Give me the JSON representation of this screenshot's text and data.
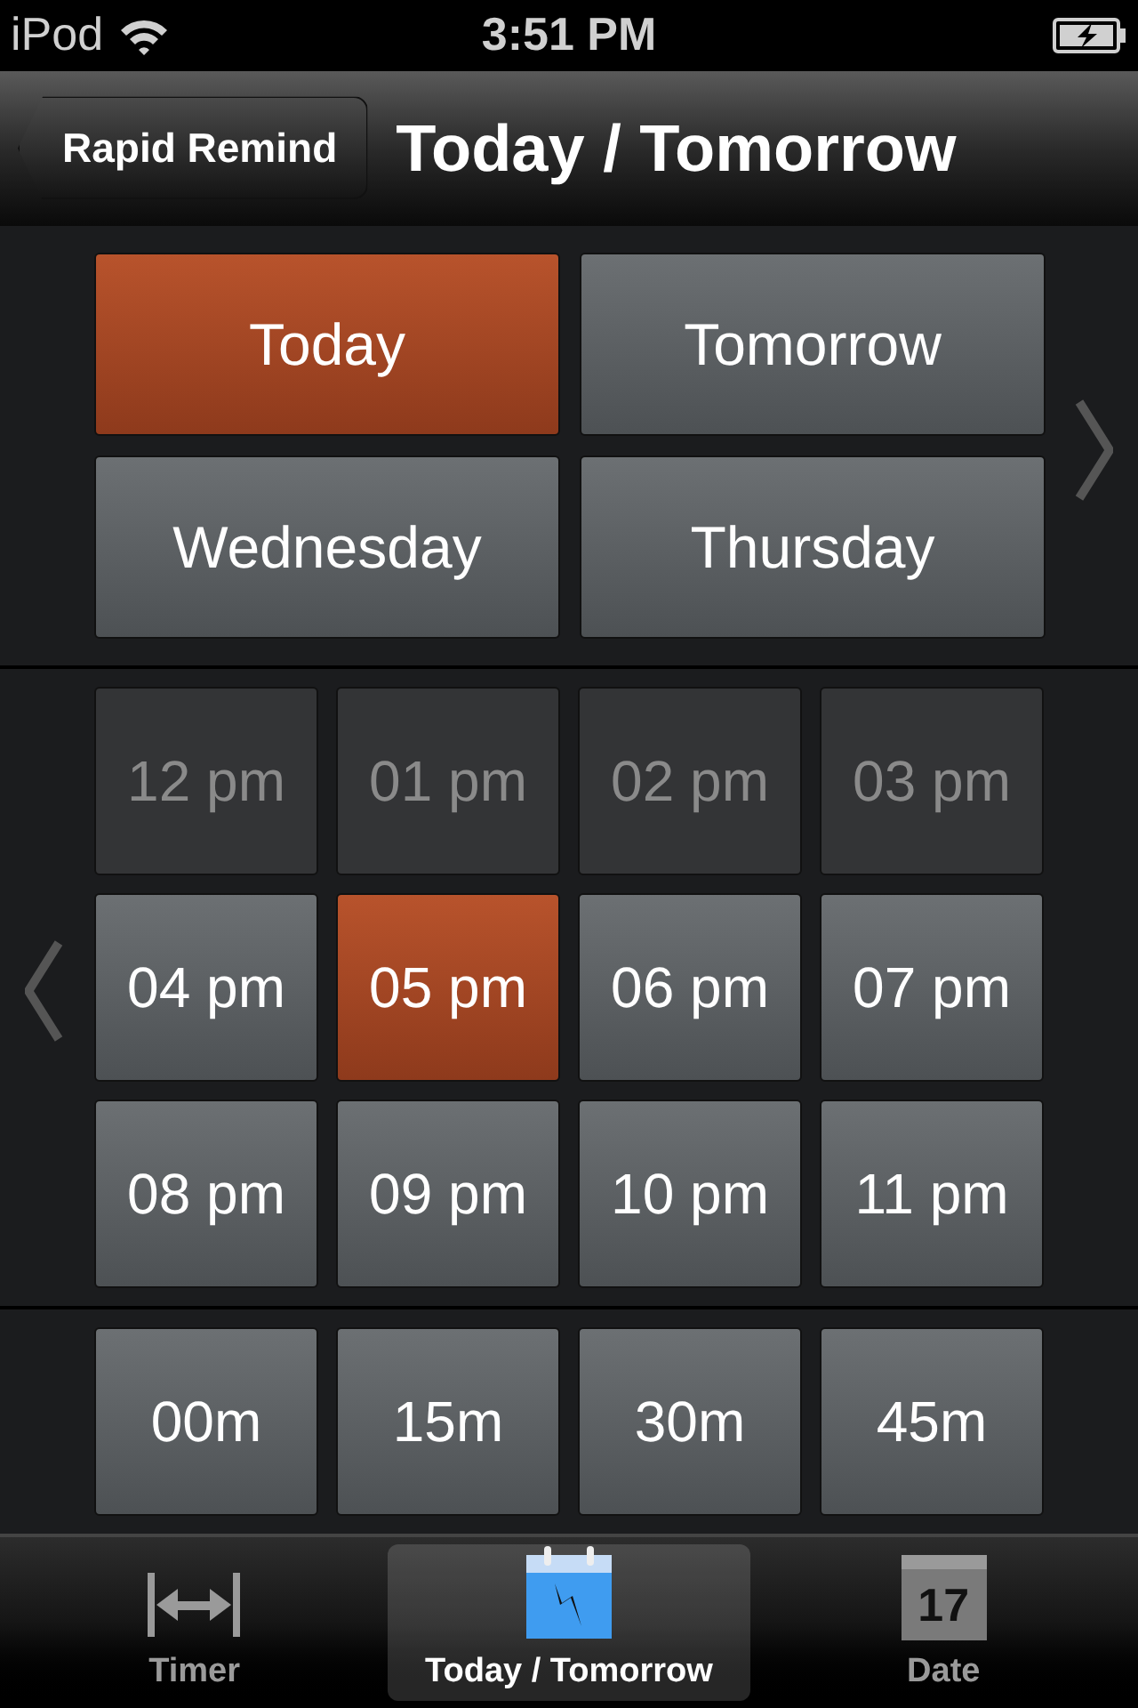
{
  "status_bar": {
    "carrier": "iPod",
    "time": "3:51 PM"
  },
  "nav_bar": {
    "back_button": "Rapid Remind",
    "title": "Today / Tomorrow"
  },
  "days": [
    {
      "label": "Today",
      "selected": true
    },
    {
      "label": "Tomorrow",
      "selected": false
    },
    {
      "label": "Wednesday",
      "selected": false
    },
    {
      "label": "Thursday",
      "selected": false
    }
  ],
  "hours": [
    {
      "label": "12 pm",
      "selected": false,
      "disabled": true
    },
    {
      "label": "01 pm",
      "selected": false,
      "disabled": true
    },
    {
      "label": "02 pm",
      "selected": false,
      "disabled": true
    },
    {
      "label": "03 pm",
      "selected": false,
      "disabled": true
    },
    {
      "label": "04 pm",
      "selected": false,
      "disabled": false
    },
    {
      "label": "05 pm",
      "selected": true,
      "disabled": false
    },
    {
      "label": "06 pm",
      "selected": false,
      "disabled": false
    },
    {
      "label": "07 pm",
      "selected": false,
      "disabled": false
    },
    {
      "label": "08 pm",
      "selected": false,
      "disabled": false
    },
    {
      "label": "09 pm",
      "selected": false,
      "disabled": false
    },
    {
      "label": "10 pm",
      "selected": false,
      "disabled": false
    },
    {
      "label": "11 pm",
      "selected": false,
      "disabled": false
    }
  ],
  "minutes": [
    {
      "label": "00m",
      "selected": false
    },
    {
      "label": "15m",
      "selected": false
    },
    {
      "label": "30m",
      "selected": false
    },
    {
      "label": "45m",
      "selected": false
    }
  ],
  "tab_bar": [
    {
      "kind": "timer",
      "label": "Timer",
      "selected": false
    },
    {
      "kind": "quick",
      "label": "Today / Tomorrow",
      "selected": true
    },
    {
      "kind": "date",
      "label": "Date",
      "selected": false,
      "icon_text": "17"
    }
  ]
}
